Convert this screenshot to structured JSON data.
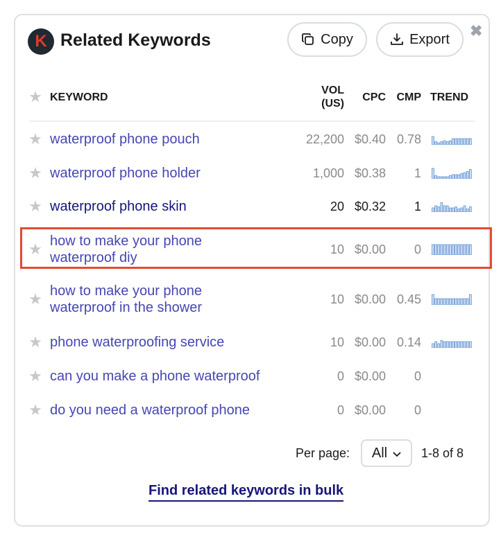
{
  "title": "Related Keywords",
  "logo_letter": "K",
  "buttons": {
    "copy": "Copy",
    "export": "Export",
    "close": "✖"
  },
  "columns": {
    "keyword": "KEYWORD",
    "vol_line1": "VOL",
    "vol_line2": "(US)",
    "cpc": "CPC",
    "cmp": "CMP",
    "trend": "TREND"
  },
  "rows": [
    {
      "keyword_line1": "waterproof phone pouch",
      "keyword_line2": "",
      "vol": "22,200",
      "cpc": "$0.40",
      "cmp": "0.78",
      "trend": [
        8,
        3,
        2,
        3,
        4,
        3,
        4,
        6,
        6,
        6,
        6,
        6,
        6,
        6
      ]
    },
    {
      "keyword_line1": "waterproof phone holder",
      "keyword_line2": "",
      "vol": "1,000",
      "cpc": "$0.38",
      "cmp": "1",
      "trend": [
        10,
        3,
        2,
        2,
        2,
        2,
        3,
        4,
        4,
        4,
        5,
        6,
        7,
        9
      ]
    },
    {
      "keyword_line1": "waterproof phone skin",
      "keyword_line2": "",
      "vol": "20",
      "cpc": "$0.32",
      "cmp": "1",
      "trend": [
        4,
        6,
        5,
        9,
        6,
        6,
        4,
        4,
        5,
        3,
        4,
        6,
        3,
        5
      ]
    },
    {
      "keyword_line1": "how to make your phone",
      "keyword_line2": "waterproof diy",
      "vol": "10",
      "cpc": "$0.00",
      "cmp": "0",
      "trend": [
        10,
        10,
        10,
        10,
        10,
        10,
        10,
        10,
        10,
        10,
        10,
        10,
        10,
        10
      ]
    },
    {
      "keyword_line1": "how to make your phone",
      "keyword_line2": "waterproof in the shower",
      "vol": "10",
      "cpc": "$0.00",
      "cmp": "0.45",
      "trend": [
        10,
        6,
        6,
        6,
        6,
        6,
        6,
        6,
        6,
        6,
        6,
        6,
        6,
        10
      ]
    },
    {
      "keyword_line1": "phone waterproofing service",
      "keyword_line2": "",
      "vol": "10",
      "cpc": "$0.00",
      "cmp": "0.14",
      "trend": [
        4,
        6,
        4,
        7,
        6,
        6,
        6,
        6,
        6,
        6,
        6,
        6,
        6,
        6
      ]
    },
    {
      "keyword_line1": "can you make a phone waterproof",
      "keyword_line2": "",
      "vol": "0",
      "cpc": "$0.00",
      "cmp": "0",
      "trend": []
    },
    {
      "keyword_line1": "do you need a waterproof phone",
      "keyword_line2": "",
      "vol": "0",
      "cpc": "$0.00",
      "cmp": "0",
      "trend": []
    }
  ],
  "pagination": {
    "per_page_label": "Per page:",
    "per_page_value": "All",
    "range": "1-8 of 8"
  },
  "bulk_link": "Find related keywords in bulk",
  "colors": {
    "keyword_link": "#4646b3",
    "keyword_visited": "#15157a",
    "trend_bar_fill": "#cfe0f4",
    "trend_bar_stroke": "#5d8fd1",
    "highlight_border": "#e34a2e"
  }
}
